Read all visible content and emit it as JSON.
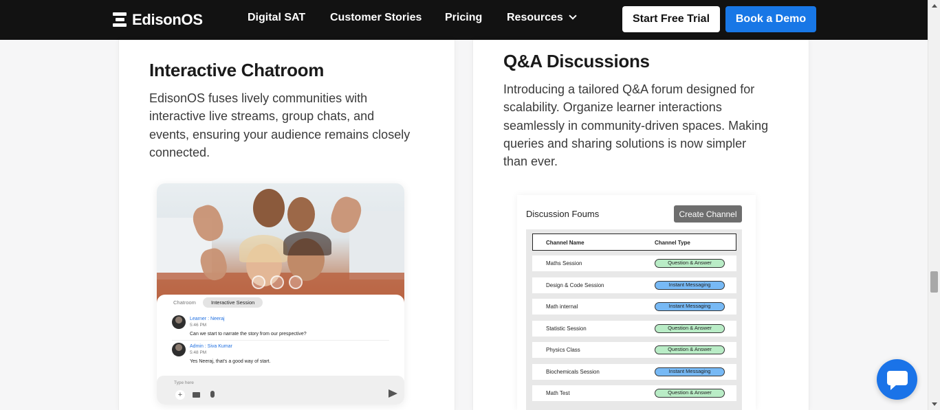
{
  "nav": {
    "logo": "EdisonOS",
    "links": [
      "Digital SAT",
      "Customer Stories",
      "Pricing",
      "Resources"
    ],
    "trial": "Start Free Trial",
    "demo": "Book a Demo"
  },
  "left_card": {
    "title": "Interactive Chatroom",
    "lines": [
      "EdisonOS fuses lively communities with",
      "interactive live streams, group chats, and",
      "events, ensuring your audience remains closely",
      "connected."
    ],
    "chat": {
      "tab_inactive": "Chatroom",
      "tab_active": "Interactive Session",
      "messages": [
        {
          "name": "Learner : Neeraj",
          "time": "5:46 PM",
          "text": "Can we start to narrate the story from our prespective?"
        },
        {
          "name": "Admin : Siva Kumar",
          "time": "5:48 PM",
          "text": "Yes Neeraj, that's a good way of start."
        }
      ],
      "input_placeholder": "Type here"
    }
  },
  "right_card": {
    "title": "Q&A Discussions",
    "lines": [
      "Introducing a tailored Q&A forum designed for",
      "scalability. Organize learner interactions",
      "seamlessly in community-driven spaces. Making",
      "queries and sharing solutions is now simpler",
      "than ever."
    ],
    "forum": {
      "title": "Discussion Foums",
      "create_button": "Create Channel",
      "headers": [
        "Channel Name",
        "Channel Type"
      ],
      "rows": [
        {
          "name": "Maths Session",
          "type": "Question & Answer",
          "color": "#b9ecc6"
        },
        {
          "name": "Design & Code Session",
          "type": "Instant Messaging",
          "color": "#77b9f5"
        },
        {
          "name": "Math internal",
          "type": "Instant Messaging",
          "color": "#77b9f5"
        },
        {
          "name": "Statistic Session",
          "type": "Question & Answer",
          "color": "#b9ecc6"
        },
        {
          "name": "Physics Class",
          "type": "Question & Answer",
          "color": "#b9ecc6"
        },
        {
          "name": "Biochemicals Session",
          "type": "Instant Messaging",
          "color": "#77b9f5"
        },
        {
          "name": "Math Test",
          "type": "Question & Answer",
          "color": "#b9ecc6"
        }
      ]
    }
  },
  "colors": {
    "nav_bg": "#121212",
    "accent": "#1877e6",
    "chat_widget": "#1a73e8"
  },
  "icons": [
    "logo-icon",
    "chevron-down-icon",
    "chat-bubble-icon",
    "send-icon",
    "plus-icon",
    "video-icon",
    "mic-icon"
  ]
}
